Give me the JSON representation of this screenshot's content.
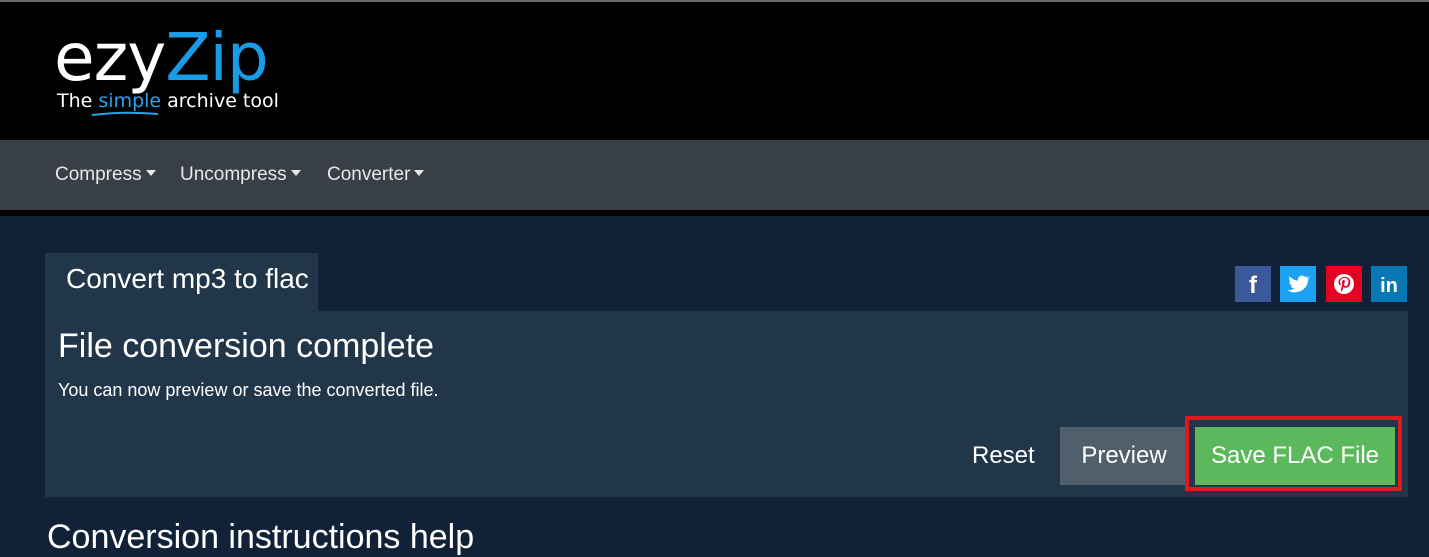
{
  "brand": {
    "logo_ezy": "ezy",
    "logo_zip": "Zip",
    "tagline_pre": "The ",
    "tagline_simple": "simple",
    "tagline_post": " archive tool",
    "accent_color": "#1a9be6"
  },
  "nav": {
    "items": [
      {
        "label": "Compress"
      },
      {
        "label": "Uncompress"
      },
      {
        "label": "Converter"
      }
    ]
  },
  "tool": {
    "tab_label": "Convert mp3 to flac"
  },
  "share": {
    "facebook": {
      "icon": "facebook-icon",
      "glyph": "f",
      "color": "#3b5998"
    },
    "twitter": {
      "icon": "twitter-icon",
      "color": "#1da1f2"
    },
    "pinterest": {
      "icon": "pinterest-icon",
      "color": "#e60023"
    },
    "linkedin": {
      "icon": "linkedin-icon",
      "glyph": "in",
      "color": "#0a77b5"
    }
  },
  "result": {
    "title": "File conversion complete",
    "message": "You can now preview or save the converted file.",
    "reset_label": "Reset",
    "preview_label": "Preview",
    "save_label": "Save FLAC File",
    "save_color": "#5cb85c",
    "highlight_color": "#e0191f"
  },
  "next_section": {
    "heading": "Conversion instructions help"
  }
}
